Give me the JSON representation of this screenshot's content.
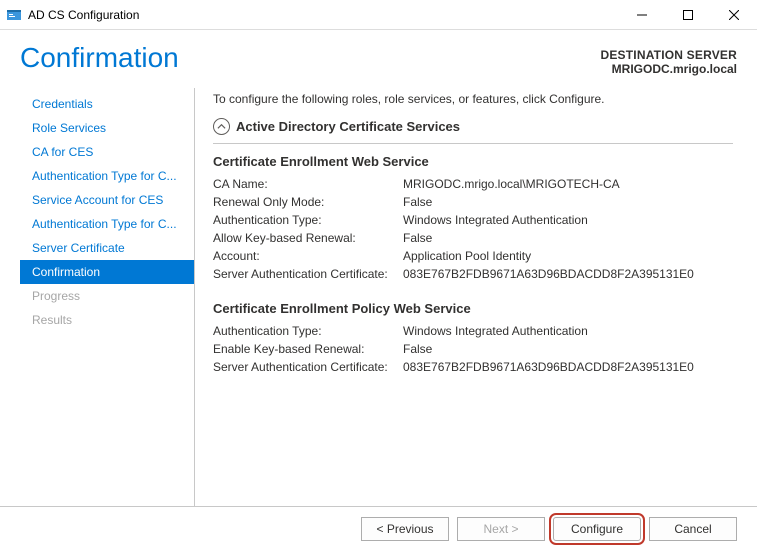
{
  "window": {
    "title": "AD CS Configuration"
  },
  "header": {
    "page_title": "Confirmation",
    "dest_label": "DESTINATION SERVER",
    "dest_name": "MRIGODC.mrigo.local"
  },
  "sidebar": {
    "items": [
      {
        "label": "Credentials",
        "state": "normal"
      },
      {
        "label": "Role Services",
        "state": "normal"
      },
      {
        "label": "CA for CES",
        "state": "normal"
      },
      {
        "label": "Authentication Type for C...",
        "state": "normal"
      },
      {
        "label": "Service Account for CES",
        "state": "normal"
      },
      {
        "label": "Authentication Type for C...",
        "state": "normal"
      },
      {
        "label": "Server Certificate",
        "state": "normal"
      },
      {
        "label": "Confirmation",
        "state": "selected"
      },
      {
        "label": "Progress",
        "state": "disabled"
      },
      {
        "label": "Results",
        "state": "disabled"
      }
    ]
  },
  "main": {
    "intro": "To configure the following roles, role services, or features, click Configure.",
    "group_title": "Active Directory Certificate Services",
    "sections": [
      {
        "title": "Certificate Enrollment Web Service",
        "rows": [
          {
            "k": "CA Name:",
            "v": "MRIGODC.mrigo.local\\MRIGOTECH-CA"
          },
          {
            "k": "Renewal Only Mode:",
            "v": "False"
          },
          {
            "k": "Authentication Type:",
            "v": "Windows Integrated Authentication"
          },
          {
            "k": "Allow Key-based Renewal:",
            "v": "False"
          },
          {
            "k": "Account:",
            "v": "Application Pool Identity"
          },
          {
            "k": "Server Authentication Certificate:",
            "v": "083E767B2FDB9671A63D96BDACDD8F2A395131E0"
          }
        ]
      },
      {
        "title": "Certificate Enrollment Policy Web Service",
        "rows": [
          {
            "k": "Authentication Type:",
            "v": "Windows Integrated Authentication"
          },
          {
            "k": "Enable Key-based Renewal:",
            "v": "False"
          },
          {
            "k": "Server Authentication Certificate:",
            "v": "083E767B2FDB9671A63D96BDACDD8F2A395131E0"
          }
        ]
      }
    ]
  },
  "footer": {
    "previous": "< Previous",
    "next": "Next >",
    "configure": "Configure",
    "cancel": "Cancel"
  }
}
